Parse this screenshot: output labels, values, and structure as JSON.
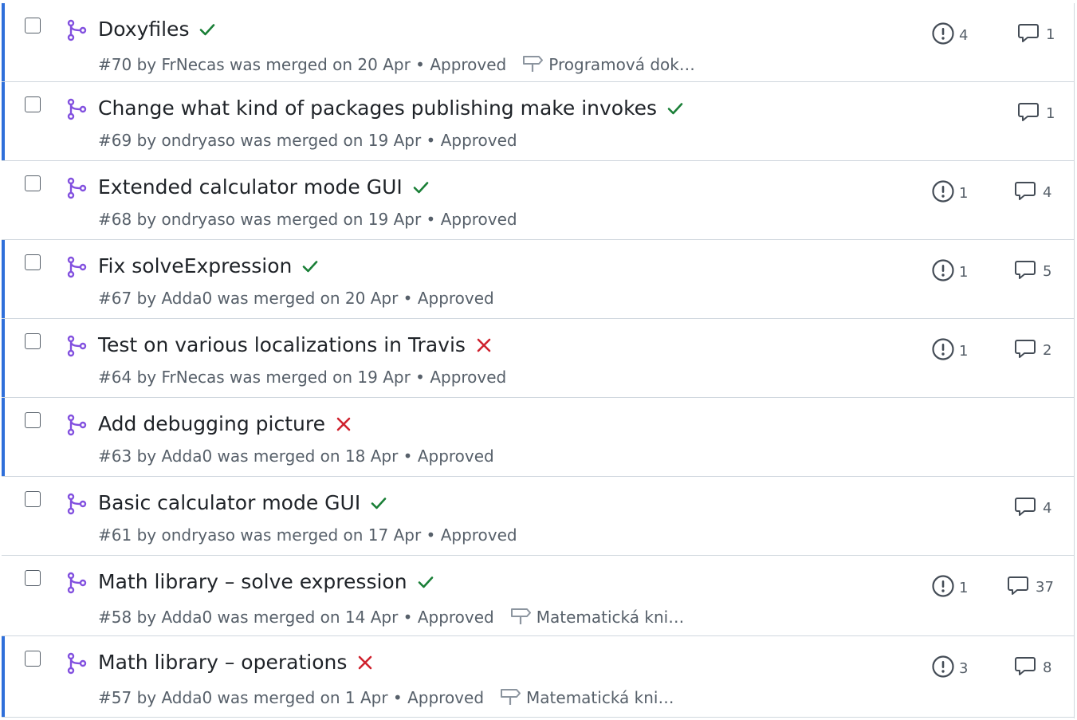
{
  "pull_requests": [
    {
      "title": "Doxyfiles",
      "status": "success",
      "number": "#70",
      "meta": "by FrNecas was merged on 20 Apr",
      "review": "Approved",
      "milestone": "Programová dok…",
      "issues": "4",
      "comments": "1",
      "unread": true
    },
    {
      "title": "Change what kind of packages publishing make invokes",
      "status": "success",
      "number": "#69",
      "meta": "by ondryaso was merged on 19 Apr",
      "review": "Approved",
      "milestone": null,
      "issues": null,
      "comments": "1",
      "unread": true
    },
    {
      "title": "Extended calculator mode GUI",
      "status": "success",
      "number": "#68",
      "meta": "by ondryaso was merged on 19 Apr",
      "review": "Approved",
      "milestone": null,
      "issues": "1",
      "comments": "4",
      "unread": false
    },
    {
      "title": "Fix solveExpression",
      "status": "success",
      "number": "#67",
      "meta": "by Adda0 was merged on 20 Apr",
      "review": "Approved",
      "milestone": null,
      "issues": "1",
      "comments": "5",
      "unread": true
    },
    {
      "title": "Test on various localizations in Travis",
      "status": "failure",
      "number": "#64",
      "meta": "by FrNecas was merged on 19 Apr",
      "review": "Approved",
      "milestone": null,
      "issues": "1",
      "comments": "2",
      "unread": true
    },
    {
      "title": "Add debugging picture",
      "status": "failure",
      "number": "#63",
      "meta": "by Adda0 was merged on 18 Apr",
      "review": "Approved",
      "milestone": null,
      "issues": null,
      "comments": null,
      "unread": true
    },
    {
      "title": "Basic calculator mode GUI",
      "status": "success",
      "number": "#61",
      "meta": "by ondryaso was merged on 17 Apr",
      "review": "Approved",
      "milestone": null,
      "issues": null,
      "comments": "4",
      "unread": false
    },
    {
      "title": "Math library – solve expression",
      "status": "success",
      "number": "#58",
      "meta": "by Adda0 was merged on 14 Apr",
      "review": "Approved",
      "milestone": "Matematická kni…",
      "issues": "1",
      "comments": "37",
      "unread": false
    },
    {
      "title": "Math library – operations",
      "status": "failure",
      "number": "#57",
      "meta": "by Adda0 was merged on 1 Apr",
      "review": "Approved",
      "milestone": "Matematická kni…",
      "issues": "3",
      "comments": "8",
      "unread": true
    }
  ],
  "colors": {
    "merged": "#8250df",
    "success": "#1a7f37",
    "failure": "#cf222e",
    "unread_marker": "#2f6fda",
    "muted": "#57606a"
  },
  "icons": {
    "merged": "git-merge-icon",
    "success": "check-icon",
    "failure": "x-icon",
    "issues": "issue-opened-icon",
    "comments": "comment-icon",
    "milestone": "milestone-icon"
  }
}
